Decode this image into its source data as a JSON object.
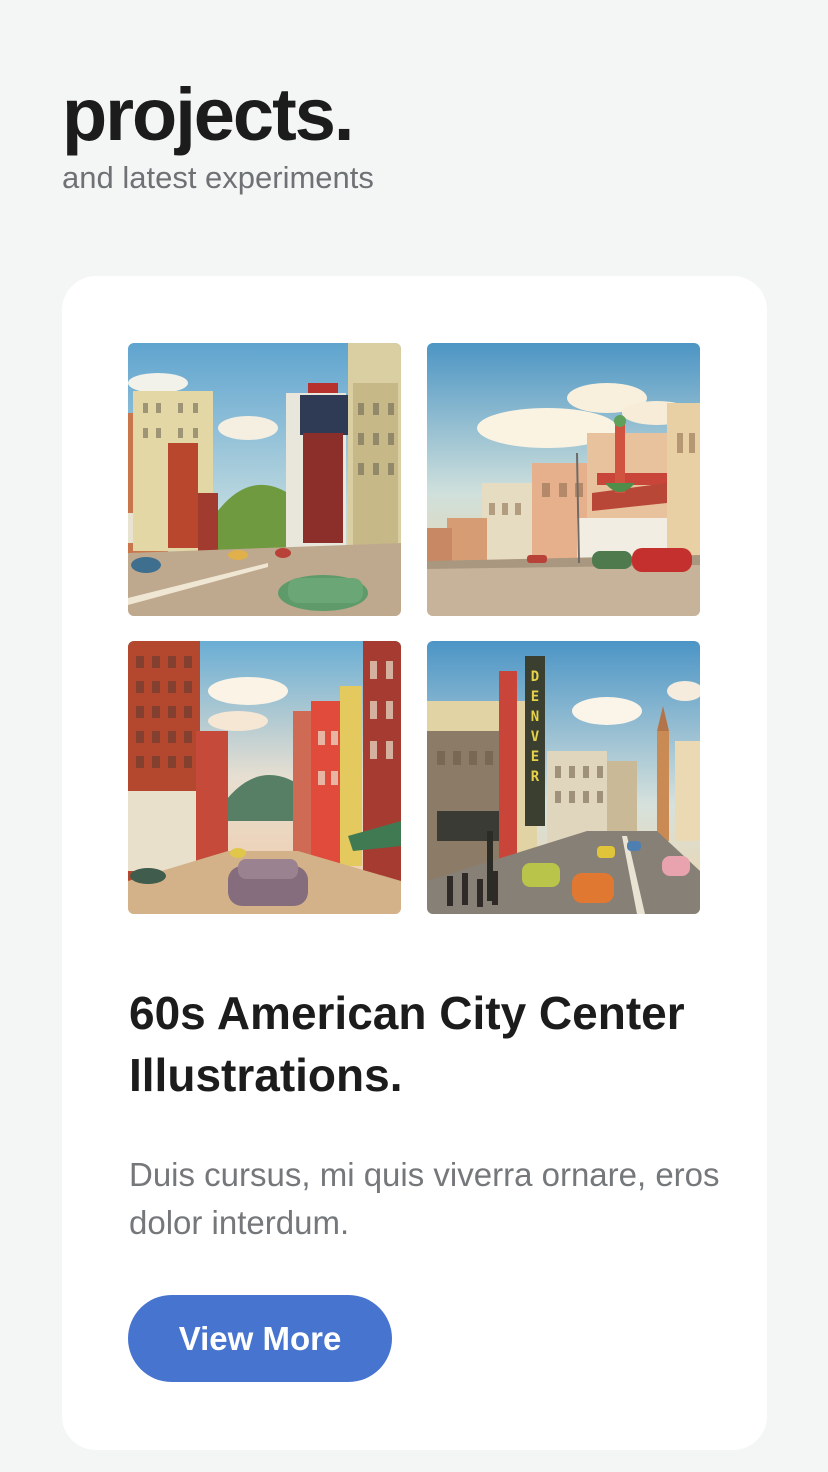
{
  "header": {
    "title": "projects.",
    "subtitle": "and latest experiments"
  },
  "project": {
    "title": "60s American City Center Illustrations.",
    "description": "Duis cursus, mi quis viverra ornare, eros dolor interdum.",
    "button_label": "View More",
    "images": [
      {
        "name": "city-street-postcard-1",
        "sign_text": "Peoples Federal SAVINGS"
      },
      {
        "name": "city-street-postcard-2"
      },
      {
        "name": "city-street-postcard-3"
      },
      {
        "name": "city-street-postcard-4",
        "sign_text": "DENVER"
      }
    ]
  },
  "colors": {
    "background": "#f4f6f6",
    "card": "#ffffff",
    "accent": "#4674cf",
    "title_text": "#1c1c1c",
    "muted_text": "#75787b"
  }
}
